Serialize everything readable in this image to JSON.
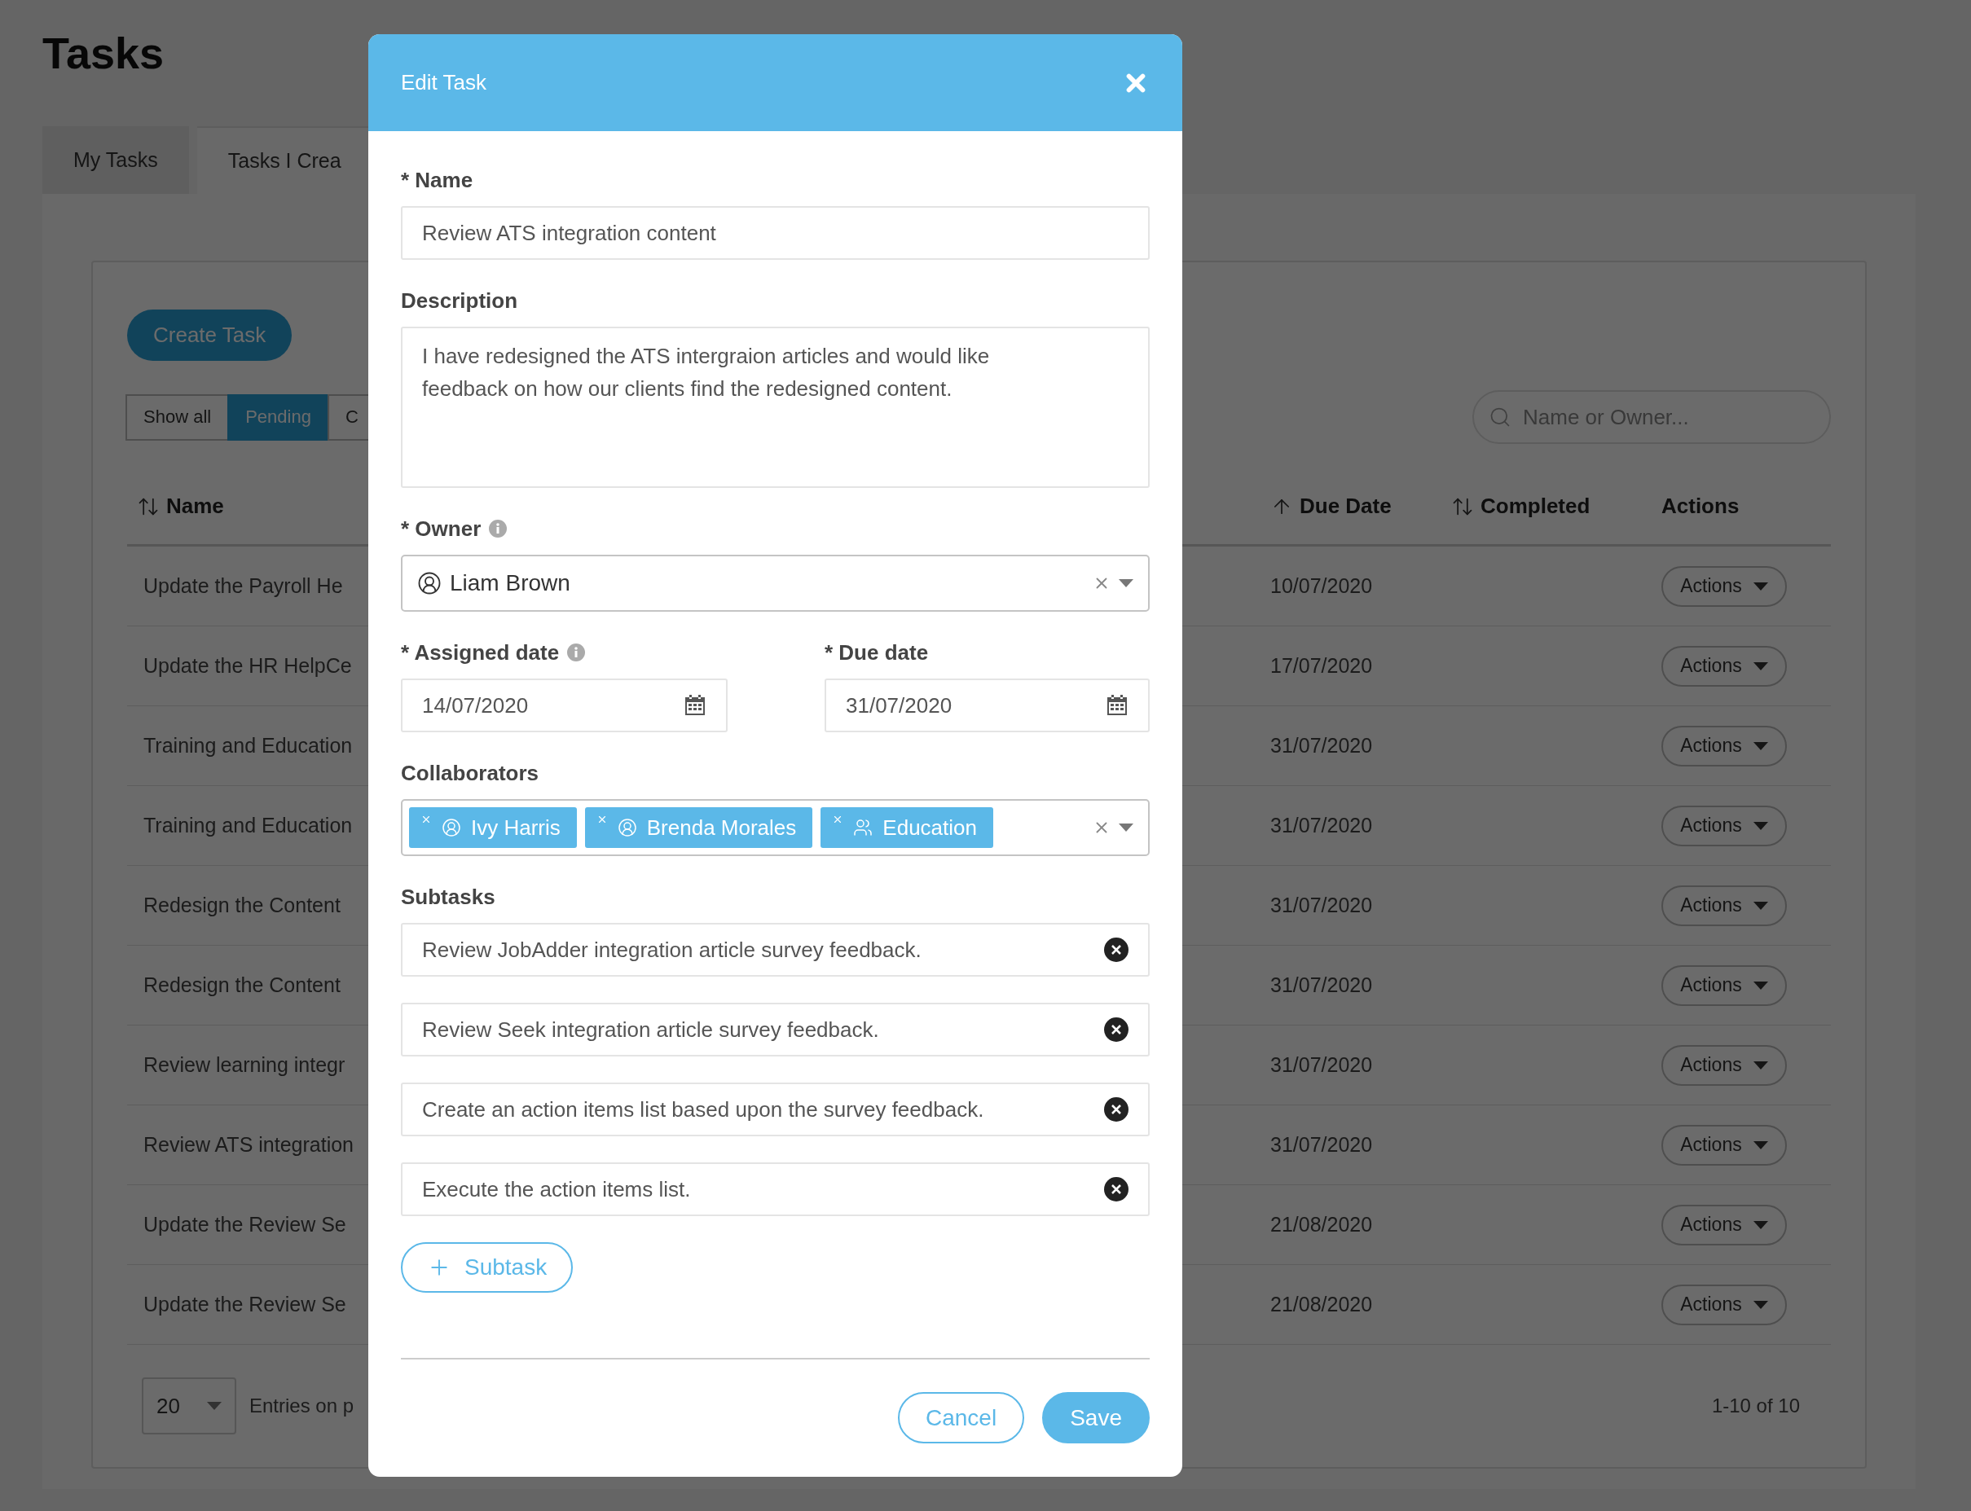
{
  "page": {
    "title": "Tasks"
  },
  "tabs": [
    {
      "label": "My Tasks",
      "selected": true
    },
    {
      "label": "Tasks I Crea",
      "selected": false
    }
  ],
  "create_button": "Create Task",
  "filters": [
    {
      "label": "Show all",
      "selected": false
    },
    {
      "label": "Pending",
      "selected": true
    },
    {
      "label": "C",
      "selected": false
    }
  ],
  "search": {
    "placeholder": "Name or Owner..."
  },
  "table": {
    "columns": [
      {
        "label": "Name",
        "kind": "sortable"
      },
      {
        "label": "Due Date",
        "kind": "ascending"
      },
      {
        "label": "Completed",
        "kind": "sortable"
      },
      {
        "label": "Actions",
        "kind": "plain"
      }
    ],
    "rows": [
      {
        "name": "Update the Payroll He",
        "due_date": "10/07/2020",
        "action": "Actions"
      },
      {
        "name": "Update the HR HelpCe",
        "due_date": "17/07/2020",
        "action": "Actions"
      },
      {
        "name": "Training and Education",
        "due_date": "31/07/2020",
        "action": "Actions"
      },
      {
        "name": "Training and Education",
        "due_date": "31/07/2020",
        "action": "Actions"
      },
      {
        "name": "Redesign the Content",
        "due_date": "31/07/2020",
        "action": "Actions"
      },
      {
        "name": "Redesign the Content",
        "due_date": "31/07/2020",
        "action": "Actions"
      },
      {
        "name": "Review learning integr",
        "due_date": "31/07/2020",
        "action": "Actions"
      },
      {
        "name": "Review ATS integration",
        "due_date": "31/07/2020",
        "action": "Actions"
      },
      {
        "name": "Update the Review Se",
        "due_date": "21/08/2020",
        "action": "Actions"
      },
      {
        "name": "Update the Review Se",
        "due_date": "21/08/2020",
        "action": "Actions"
      }
    ]
  },
  "pagination": {
    "page_size": "20",
    "entries_label": "Entries on p",
    "range": "1-10 of 10"
  },
  "modal": {
    "title": "Edit Task",
    "name": {
      "label": "* Name",
      "value": "Review ATS integration content"
    },
    "description": {
      "label": "Description",
      "value": "I have redesigned the ATS intergraion articles and would like feedback on how our clients find the redesigned content."
    },
    "owner": {
      "label": "* Owner",
      "info": true,
      "value": "Liam Brown"
    },
    "assigned_date": {
      "label": "* Assigned date",
      "info": true,
      "value": "14/07/2020"
    },
    "due_date": {
      "label": "* Due date",
      "info": false,
      "value": "31/07/2020"
    },
    "collaborators": {
      "label": "Collaborators",
      "items": [
        {
          "name": "Ivy Harris",
          "kind": "person"
        },
        {
          "name": "Brenda Morales",
          "kind": "person"
        },
        {
          "name": "Education",
          "kind": "group"
        }
      ]
    },
    "subtasks": {
      "label": "Subtasks",
      "items": [
        "Review JobAdder integration article survey feedback.",
        "Review Seek integration article survey feedback.",
        "Create an action items list based upon the survey feedback.",
        "Execute the action items list."
      ],
      "add_button": "Subtask"
    },
    "buttons": {
      "cancel": "Cancel",
      "save": "Save"
    }
  }
}
